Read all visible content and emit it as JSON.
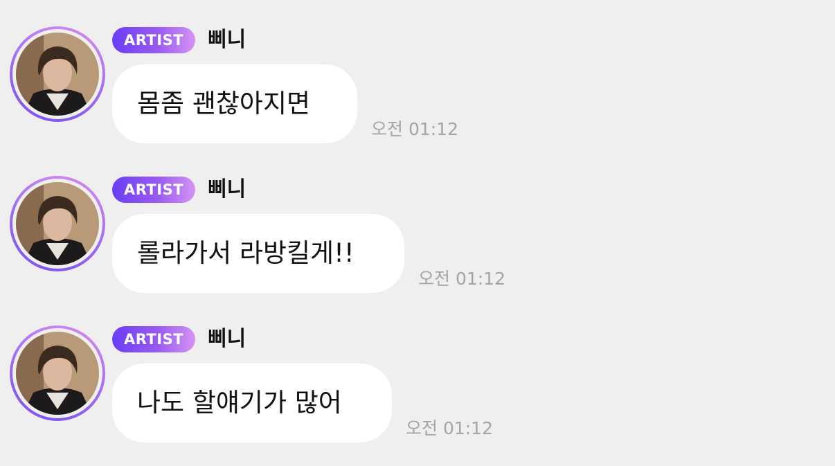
{
  "messages": [
    {
      "badge": "ARTIST",
      "name": "삐니",
      "text": "몸좀 괜찮아지면",
      "time": "오전 01:12"
    },
    {
      "badge": "ARTIST",
      "name": "삐니",
      "text": "롤라가서 라방킬게!!",
      "time": "오전 01:12"
    },
    {
      "badge": "ARTIST",
      "name": "삐니",
      "text": "나도 할얘기가 많어",
      "time": "오전 01:12"
    }
  ],
  "colors": {
    "background": "#efefef",
    "bubble": "#ffffff",
    "badge_gradient_start": "#6a3ef5",
    "badge_gradient_end": "#d494f2",
    "timestamp": "#a4a4a4"
  }
}
